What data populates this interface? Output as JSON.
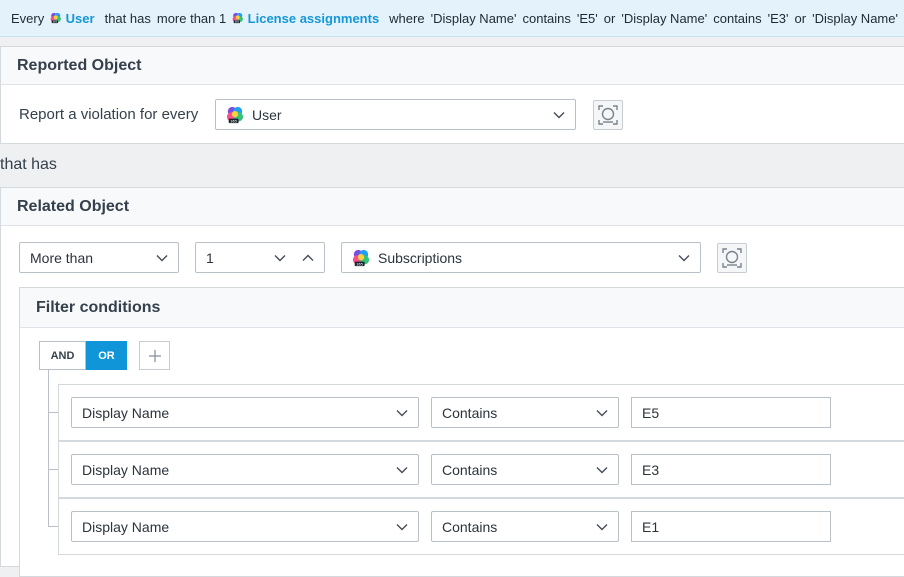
{
  "summary": {
    "every": "Every",
    "object": "User",
    "that_has": "that has",
    "more_than": "more than 1",
    "related": "License assignments",
    "where": "where",
    "c1_field": "'Display Name'",
    "c1_op": "contains",
    "c1_val": "'E5'",
    "or1": "or",
    "c2_field": "'Display Name'",
    "c2_op": "contains",
    "c2_val": "'E3'",
    "or2": "or",
    "c3_field": "'Display Name'"
  },
  "reported": {
    "title": "Reported Object",
    "label": "Report a violation for every",
    "object_value": "User",
    "object_icon": "m365-icon"
  },
  "connector_text": "that has",
  "related": {
    "title": "Related Object",
    "quantifier": "More than",
    "count": "1",
    "object_value": "Subscriptions",
    "object_icon": "m365-icon"
  },
  "filter": {
    "title": "Filter conditions",
    "and_label": "AND",
    "or_label": "OR",
    "active_operator": "OR",
    "conditions": [
      {
        "field": "Display Name",
        "operator": "Contains",
        "value": "E5"
      },
      {
        "field": "Display Name",
        "operator": "Contains",
        "value": "E3"
      },
      {
        "field": "Display Name",
        "operator": "Contains",
        "value": "E1"
      }
    ]
  },
  "colors": {
    "accent": "#0f95d8",
    "link": "#1697d7",
    "summary_bg": "#e3f2fb"
  }
}
